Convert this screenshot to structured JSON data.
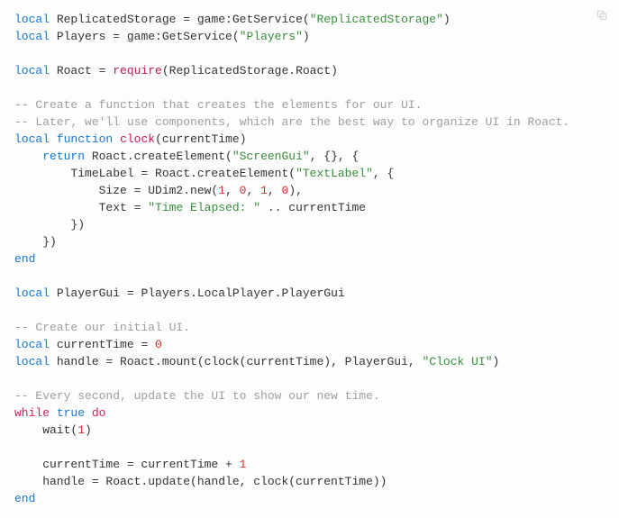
{
  "copy_tooltip": "Copy",
  "lines": [
    [
      [
        "k",
        "local"
      ],
      [
        "id",
        " ReplicatedStorage "
      ],
      [
        "id",
        "= game:GetService("
      ],
      [
        "str",
        "\"ReplicatedStorage\""
      ],
      [
        "id",
        ")"
      ]
    ],
    [
      [
        "k",
        "local"
      ],
      [
        "id",
        " Players "
      ],
      [
        "id",
        "= game:GetService("
      ],
      [
        "str",
        "\"Players\""
      ],
      [
        "id",
        ")"
      ]
    ],
    [],
    [
      [
        "k",
        "local"
      ],
      [
        "id",
        " Roact "
      ],
      [
        "id",
        "= "
      ],
      [
        "fn",
        "require"
      ],
      [
        "id",
        "(ReplicatedStorage.Roact)"
      ]
    ],
    [],
    [
      [
        "com",
        "-- Create a function that creates the elements for our UI."
      ]
    ],
    [
      [
        "com",
        "-- Later, we'll use components, which are the best way to organize UI in Roact."
      ]
    ],
    [
      [
        "k",
        "local"
      ],
      [
        "id",
        " "
      ],
      [
        "k",
        "function"
      ],
      [
        "id",
        " "
      ],
      [
        "fn",
        "clock"
      ],
      [
        "id",
        "(currentTime)"
      ]
    ],
    [
      [
        "id",
        "    "
      ],
      [
        "k",
        "return"
      ],
      [
        "id",
        " Roact.createElement("
      ],
      [
        "str",
        "\"ScreenGui\""
      ],
      [
        "id",
        ", {}, {"
      ]
    ],
    [
      [
        "id",
        "        TimeLabel = Roact.createElement("
      ],
      [
        "str",
        "\"TextLabel\""
      ],
      [
        "id",
        ", {"
      ]
    ],
    [
      [
        "id",
        "            Size = UDim2.new("
      ],
      [
        "num",
        "1"
      ],
      [
        "id",
        ", "
      ],
      [
        "num",
        "0"
      ],
      [
        "id",
        ", "
      ],
      [
        "num",
        "1"
      ],
      [
        "id",
        ", "
      ],
      [
        "num",
        "0"
      ],
      [
        "id",
        "),"
      ]
    ],
    [
      [
        "id",
        "            Text = "
      ],
      [
        "str",
        "\"Time Elapsed: \""
      ],
      [
        "id",
        " .. currentTime"
      ]
    ],
    [
      [
        "id",
        "        })"
      ]
    ],
    [
      [
        "id",
        "    })"
      ]
    ],
    [
      [
        "k",
        "end"
      ]
    ],
    [],
    [
      [
        "k",
        "local"
      ],
      [
        "id",
        " PlayerGui "
      ],
      [
        "id",
        "= Players.LocalPlayer.PlayerGui"
      ]
    ],
    [],
    [
      [
        "com",
        "-- Create our initial UI."
      ]
    ],
    [
      [
        "k",
        "local"
      ],
      [
        "id",
        " currentTime "
      ],
      [
        "id",
        "= "
      ],
      [
        "num",
        "0"
      ]
    ],
    [
      [
        "k",
        "local"
      ],
      [
        "id",
        " handle "
      ],
      [
        "id",
        "= Roact.mount(clock(currentTime), PlayerGui, "
      ],
      [
        "str",
        "\"Clock UI\""
      ],
      [
        "id",
        ")"
      ]
    ],
    [],
    [
      [
        "com",
        "-- Every second, update the UI to show our new time."
      ]
    ],
    [
      [
        "kw2",
        "while"
      ],
      [
        "id",
        " "
      ],
      [
        "k",
        "true"
      ],
      [
        "id",
        " "
      ],
      [
        "kw2",
        "do"
      ]
    ],
    [
      [
        "id",
        "    wait("
      ],
      [
        "num",
        "1"
      ],
      [
        "id",
        ")"
      ]
    ],
    [],
    [
      [
        "id",
        "    currentTime = currentTime + "
      ],
      [
        "num",
        "1"
      ]
    ],
    [
      [
        "id",
        "    handle = Roact.update(handle, clock(currentTime))"
      ]
    ],
    [
      [
        "k",
        "end"
      ]
    ]
  ]
}
